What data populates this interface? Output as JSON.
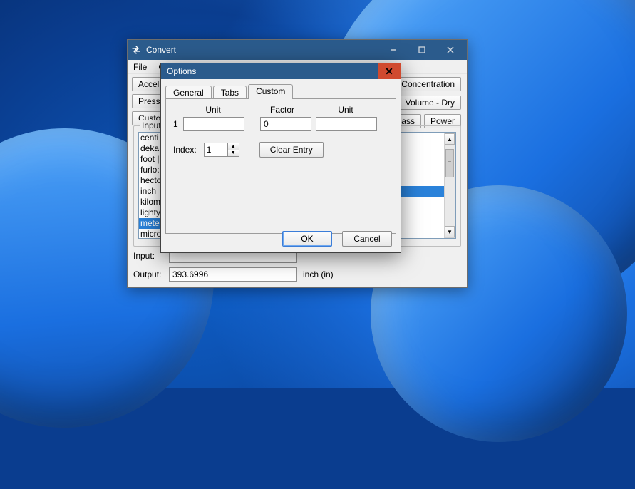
{
  "main_window": {
    "title": "Convert",
    "menu": {
      "file": "File",
      "options_trunc": "O"
    },
    "cat_row1": [
      "Accel",
      "Concentration"
    ],
    "cat_row2": [
      "Press",
      "Volume - Dry"
    ],
    "cat_row3": [
      "Custor",
      "lass",
      "Power"
    ],
    "group_legend": "Input",
    "list_items": [
      "centi",
      "deka",
      "foot |",
      "furlo:",
      "hecto",
      "inch",
      "kilom",
      "lighty",
      "mete",
      "micro"
    ],
    "list_selected_index": 8,
    "input_label": "Input:",
    "input_value": "",
    "output_label": "Output:",
    "output_value": "393.6996",
    "output_unit": "inch (in)"
  },
  "dialog": {
    "title": "Options",
    "tabs": [
      "General",
      "Tabs",
      "Custom"
    ],
    "active_tab": 2,
    "col_unit_a": "Unit",
    "col_factor": "Factor",
    "col_unit_b": "Unit",
    "row_number": "1",
    "unit_a_value": "",
    "equals": "=",
    "factor_value": "0",
    "unit_b_value": "",
    "index_label": "Index:",
    "index_value": "1",
    "clear_entry": "Clear Entry",
    "ok": "OK",
    "cancel": "Cancel"
  }
}
